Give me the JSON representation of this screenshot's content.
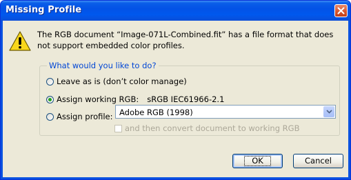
{
  "window": {
    "title": "Missing Profile"
  },
  "message": "The RGB document “Image-071L-Combined.fit” has a file format that does not support embedded color profiles.",
  "group": {
    "legend": "What would you like to do?",
    "options": [
      {
        "label": "Leave as is (don’t color manage)",
        "checked": false
      },
      {
        "label": "Assign working RGB:",
        "value": "sRGB IEC61966-2.1",
        "checked": true
      },
      {
        "label": "Assign profile:",
        "checked": false
      }
    ],
    "profile_select": {
      "selected": "Adobe RGB (1998)"
    },
    "convert_checkbox": {
      "label": "and then convert document to working RGB",
      "checked": false,
      "enabled": false
    }
  },
  "buttons": {
    "ok": "OK",
    "cancel": "Cancel"
  },
  "icons": {
    "warning": "warning-icon",
    "close": "close-icon",
    "dropdown": "chevron-down-icon"
  },
  "colors": {
    "titlebar": "#0a5ee8",
    "dialog_bg": "#ece9d8",
    "group_legend": "#0046d5",
    "close_button": "#d9572e"
  }
}
